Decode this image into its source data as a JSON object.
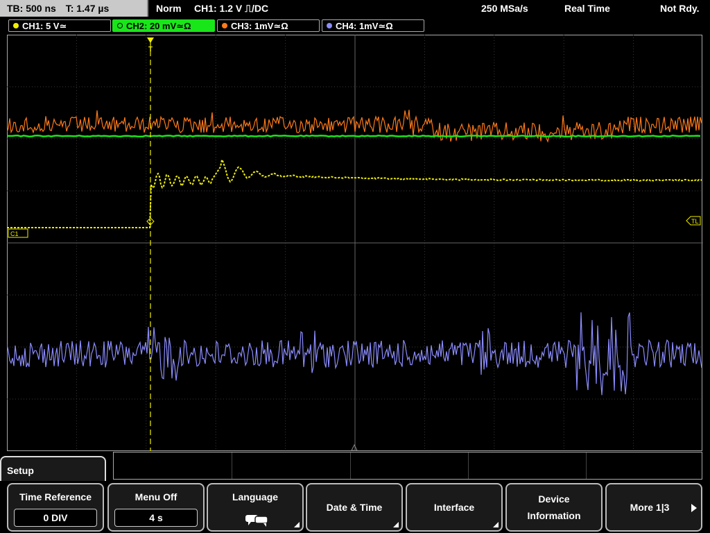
{
  "topbar": {
    "timebase": "TB: 500 ns",
    "time_pos": "T: 1.47 µs",
    "trigger_mode": "Norm",
    "trigger_info": "CH1: 1.2 V ⎍/DC",
    "sample_rate": "250 MSa/s",
    "acq_mode": "Real Time",
    "status": "Not Rdy."
  },
  "channels": [
    {
      "label": "CH1: 5 V≃",
      "color": "#f0f000"
    },
    {
      "label": "CH2: 20 mV≃Ω",
      "color": "#19e619"
    },
    {
      "label": "CH3: 1mV≃Ω",
      "color": "#ff7a1a"
    },
    {
      "label": "CH4: 1mV≃Ω",
      "color": "#8c8cff"
    }
  ],
  "markers": {
    "ch1": "C1",
    "trigger_level": "TL",
    "trigger_pos": "T"
  },
  "menu": {
    "title": "Setup",
    "softkeys": {
      "time_reference": {
        "title": "Time Reference",
        "value": "0 DIV"
      },
      "menu_off": {
        "title": "Menu Off",
        "value": "4 s"
      },
      "language": {
        "title": "Language",
        "icon": "speech-bubbles-icon"
      },
      "date_time": {
        "title": "Date & Time"
      },
      "interface": {
        "title": "Interface"
      },
      "device_info": {
        "line1": "Device",
        "line2": "Information"
      },
      "more": {
        "title": "More 1|3"
      }
    }
  }
}
